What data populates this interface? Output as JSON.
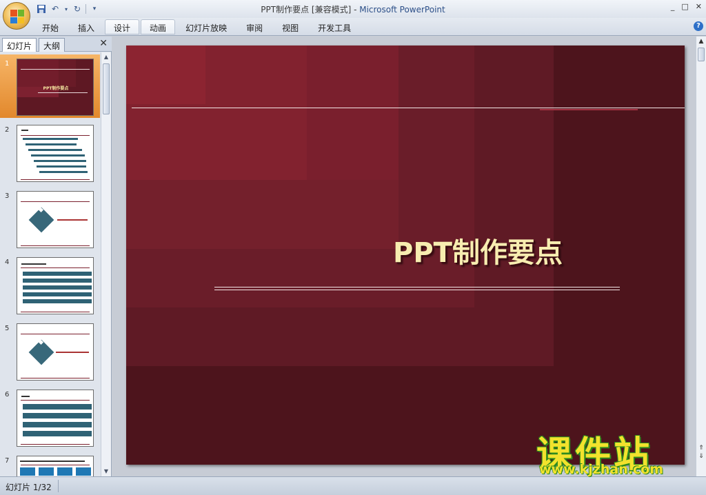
{
  "window": {
    "title_doc": "PPT制作要点 [兼容模式]",
    "title_sep": " - ",
    "title_app": "Microsoft PowerPoint",
    "controls": [
      "_",
      "□",
      "✕"
    ]
  },
  "qat": {
    "save_icon": "save-icon",
    "undo_icon": "undo-icon",
    "redo_icon": "redo-icon",
    "customize_icon": "customize-qat-icon"
  },
  "ribbon": {
    "tabs": [
      {
        "label": "开始"
      },
      {
        "label": "插入"
      },
      {
        "label": "设计"
      },
      {
        "label": "动画"
      },
      {
        "label": "幻灯片放映"
      },
      {
        "label": "审阅"
      },
      {
        "label": "视图"
      },
      {
        "label": "开发工具"
      }
    ],
    "active_tabs": [
      "设计",
      "动画"
    ],
    "help": "?"
  },
  "left_pane": {
    "tab_slides": "幻灯片",
    "tab_outline": "大纲",
    "close": "✕",
    "thumbnails": [
      {
        "num": "1",
        "title": "PPT制作要点",
        "selected": true
      },
      {
        "num": "2"
      },
      {
        "num": "3"
      },
      {
        "num": "4"
      },
      {
        "num": "5"
      },
      {
        "num": "6"
      },
      {
        "num": "7"
      }
    ]
  },
  "slide": {
    "title": "PPT制作要点",
    "colors": {
      "background": "#4d141c",
      "title": "#f7edb0"
    }
  },
  "statusbar": {
    "slide_indicator": "幻灯片 1/32"
  },
  "watermark": {
    "text_cn": "课件站",
    "url": "www.kjzhan.com"
  }
}
